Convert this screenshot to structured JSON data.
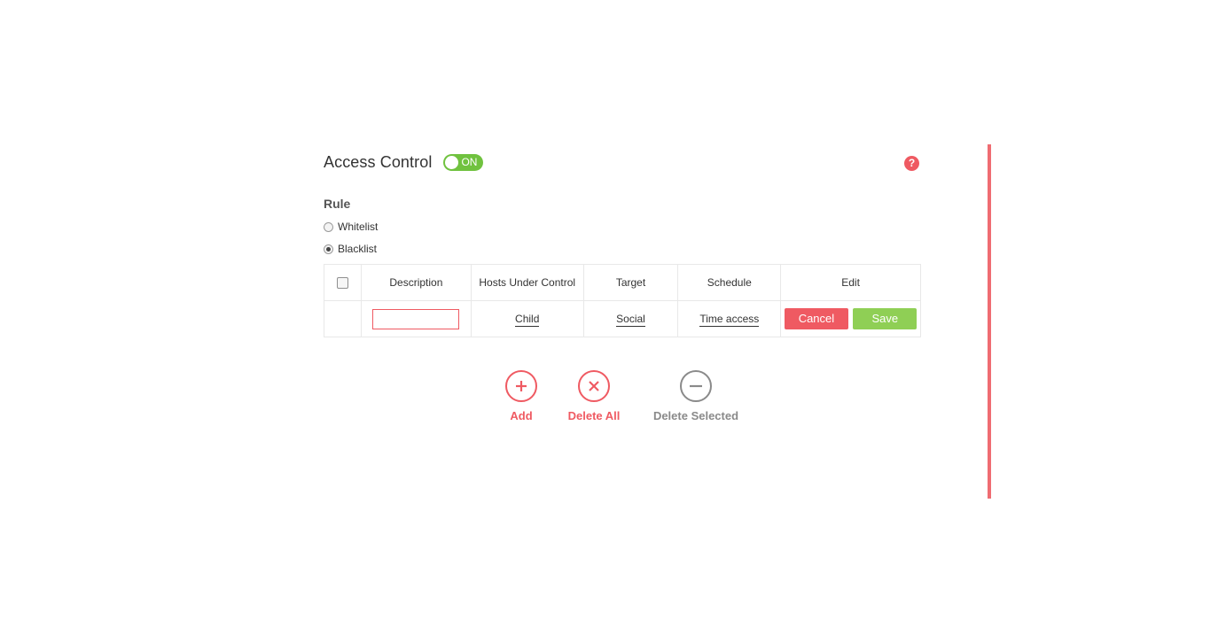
{
  "header": {
    "title": "Access Control",
    "toggle_label": "ON",
    "help_glyph": "?"
  },
  "rule": {
    "label": "Rule",
    "options": [
      {
        "label": "Whitelist",
        "checked": false
      },
      {
        "label": "Blacklist",
        "checked": true
      }
    ]
  },
  "table": {
    "columns": [
      "Description",
      "Hosts Under Control",
      "Target",
      "Schedule",
      "Edit"
    ],
    "row": {
      "description_value": "",
      "hosts": "Child",
      "target": "Social",
      "schedule": "Time access",
      "cancel_label": "Cancel",
      "save_label": "Save"
    }
  },
  "actions": {
    "add": "Add",
    "delete_all": "Delete All",
    "delete_selected": "Delete Selected"
  },
  "colors": {
    "accent": "#ef5a62",
    "toggle_on": "#70c23f",
    "save": "#8fcf55",
    "disabled": "#8a8a8a"
  },
  "icons": [
    "help-icon",
    "plus-icon",
    "close-icon",
    "minus-icon"
  ]
}
